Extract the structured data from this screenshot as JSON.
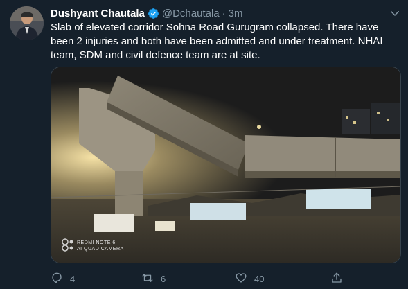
{
  "tweet": {
    "display_name": "Dushyant Chautala",
    "handle": "@Dchautala",
    "separator": "·",
    "time": "3m",
    "text": "Slab of elevated corridor Sohna Road Gurugram collapsed. There have been 2 injuries and both have been admitted and under treatment. NHAI team, SDM and civil defence team are at site.",
    "watermark_line1": "REDMI NOTE 6",
    "watermark_line2": "AI QUAD CAMERA"
  },
  "actions": {
    "reply_count": "4",
    "retweet_count": "6",
    "like_count": "40"
  },
  "icons": {
    "verified": "verified-badge-icon",
    "more": "chevron-down-icon",
    "reply": "reply-icon",
    "retweet": "retweet-icon",
    "like": "heart-icon",
    "share": "share-icon"
  },
  "colors": {
    "background": "#15202b",
    "secondary_text": "#8899a6",
    "verified": "#1da1f2"
  }
}
